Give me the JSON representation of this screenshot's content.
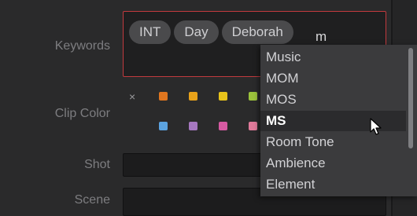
{
  "labels": {
    "keywords": "Keywords",
    "clip_color": "Clip Color",
    "shot": "Shot",
    "scene": "Scene"
  },
  "keywords_field": {
    "tags": [
      "INT",
      "Day",
      "Deborah"
    ],
    "typed_text": "m"
  },
  "clip_color": {
    "clear_icon": "×",
    "row1": [
      "#e0761f",
      "#e8a21a",
      "#e8c31b",
      "#9cc23c"
    ],
    "row2": [
      "#5ba3e0",
      "#a678c0",
      "#d65aa2",
      "#e07a9a"
    ]
  },
  "dropdown": {
    "items": [
      "Music",
      "MOM",
      "MOS",
      "MS",
      "Room Tone",
      "Ambience",
      "Element"
    ],
    "selected_index": 3
  },
  "colors": {
    "accent_border": "#c23a3e",
    "background": "#2a2a2b"
  }
}
